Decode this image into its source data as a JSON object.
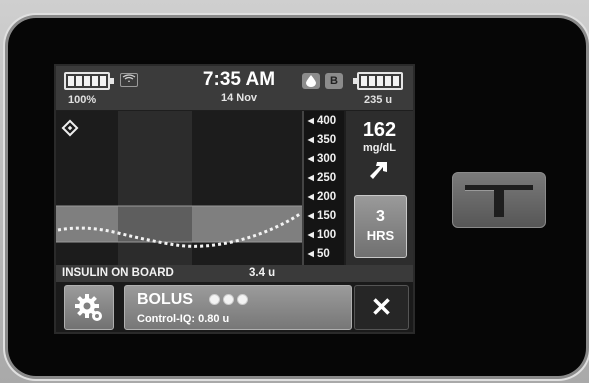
{
  "status": {
    "battery_percent": "100%",
    "time": "7:35 AM",
    "date": "14 Nov",
    "badge_b": "B",
    "reservoir_units": "235 u"
  },
  "graph": {
    "ticks": [
      "400",
      "350",
      "300",
      "250",
      "200",
      "150",
      "100",
      "50"
    ]
  },
  "glucose": {
    "value": "162",
    "unit": "mg/dL",
    "trend_icon": "arrow-up-right-icon"
  },
  "range_button": {
    "value": "3",
    "label": "HRS"
  },
  "iob": {
    "label": "INSULIN ON BOARD",
    "value": "3.4 u"
  },
  "bolus": {
    "title": "BOLUS",
    "subtitle": "Control-IQ: 0.80 u"
  },
  "close_label": "✕"
}
